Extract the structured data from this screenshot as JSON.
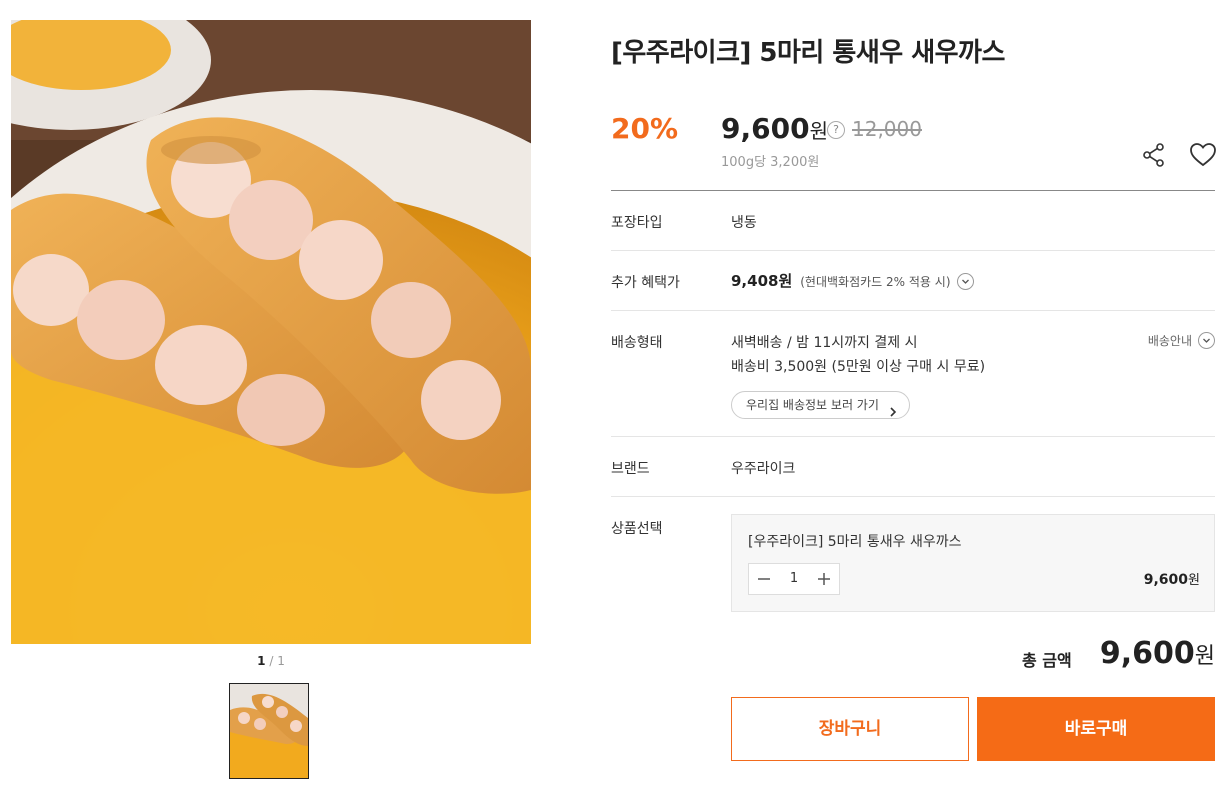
{
  "product": {
    "title": "[우주라이크] 5마리 통새우 새우까스",
    "discount_rate": "20%",
    "price": "9,600",
    "price_unit": "원",
    "help_symbol": "?",
    "original_price": "12,000",
    "unit_price": "100g당 3,200원"
  },
  "gallery": {
    "current": "1",
    "separator": "/",
    "total": "1"
  },
  "actions": {
    "share_icon": "share-icon",
    "wishlist_icon": "heart-icon"
  },
  "info": {
    "packaging_label": "포장타입",
    "packaging_value": "냉동",
    "benefit_label": "추가 혜택가",
    "benefit_price": "9,408원",
    "benefit_note": "(현대백화점카드 2% 적용 시)",
    "delivery_label": "배송형태",
    "delivery_line1": "새벽배송 / 밤 11시까지 결제 시",
    "delivery_line2": "배송비 3,500원 (5만원 이상 구매 시 무료)",
    "delivery_guide": "배송안내",
    "delivery_info_button": "우리집 배송정보 보러 가기",
    "brand_label": "브랜드",
    "brand_value": "우주라이크",
    "option_label": "상품선택"
  },
  "option": {
    "name": "[우주라이크] 5마리 통새우 새우까스",
    "quantity": "1",
    "price": "9,600",
    "price_unit": "원"
  },
  "total": {
    "label": "총 금액",
    "price": "9,600",
    "unit": "원"
  },
  "buttons": {
    "cart": "장바구니",
    "buy": "바로구매"
  },
  "colors": {
    "accent": "#f26b1d",
    "buy_button": "#f56b16"
  }
}
